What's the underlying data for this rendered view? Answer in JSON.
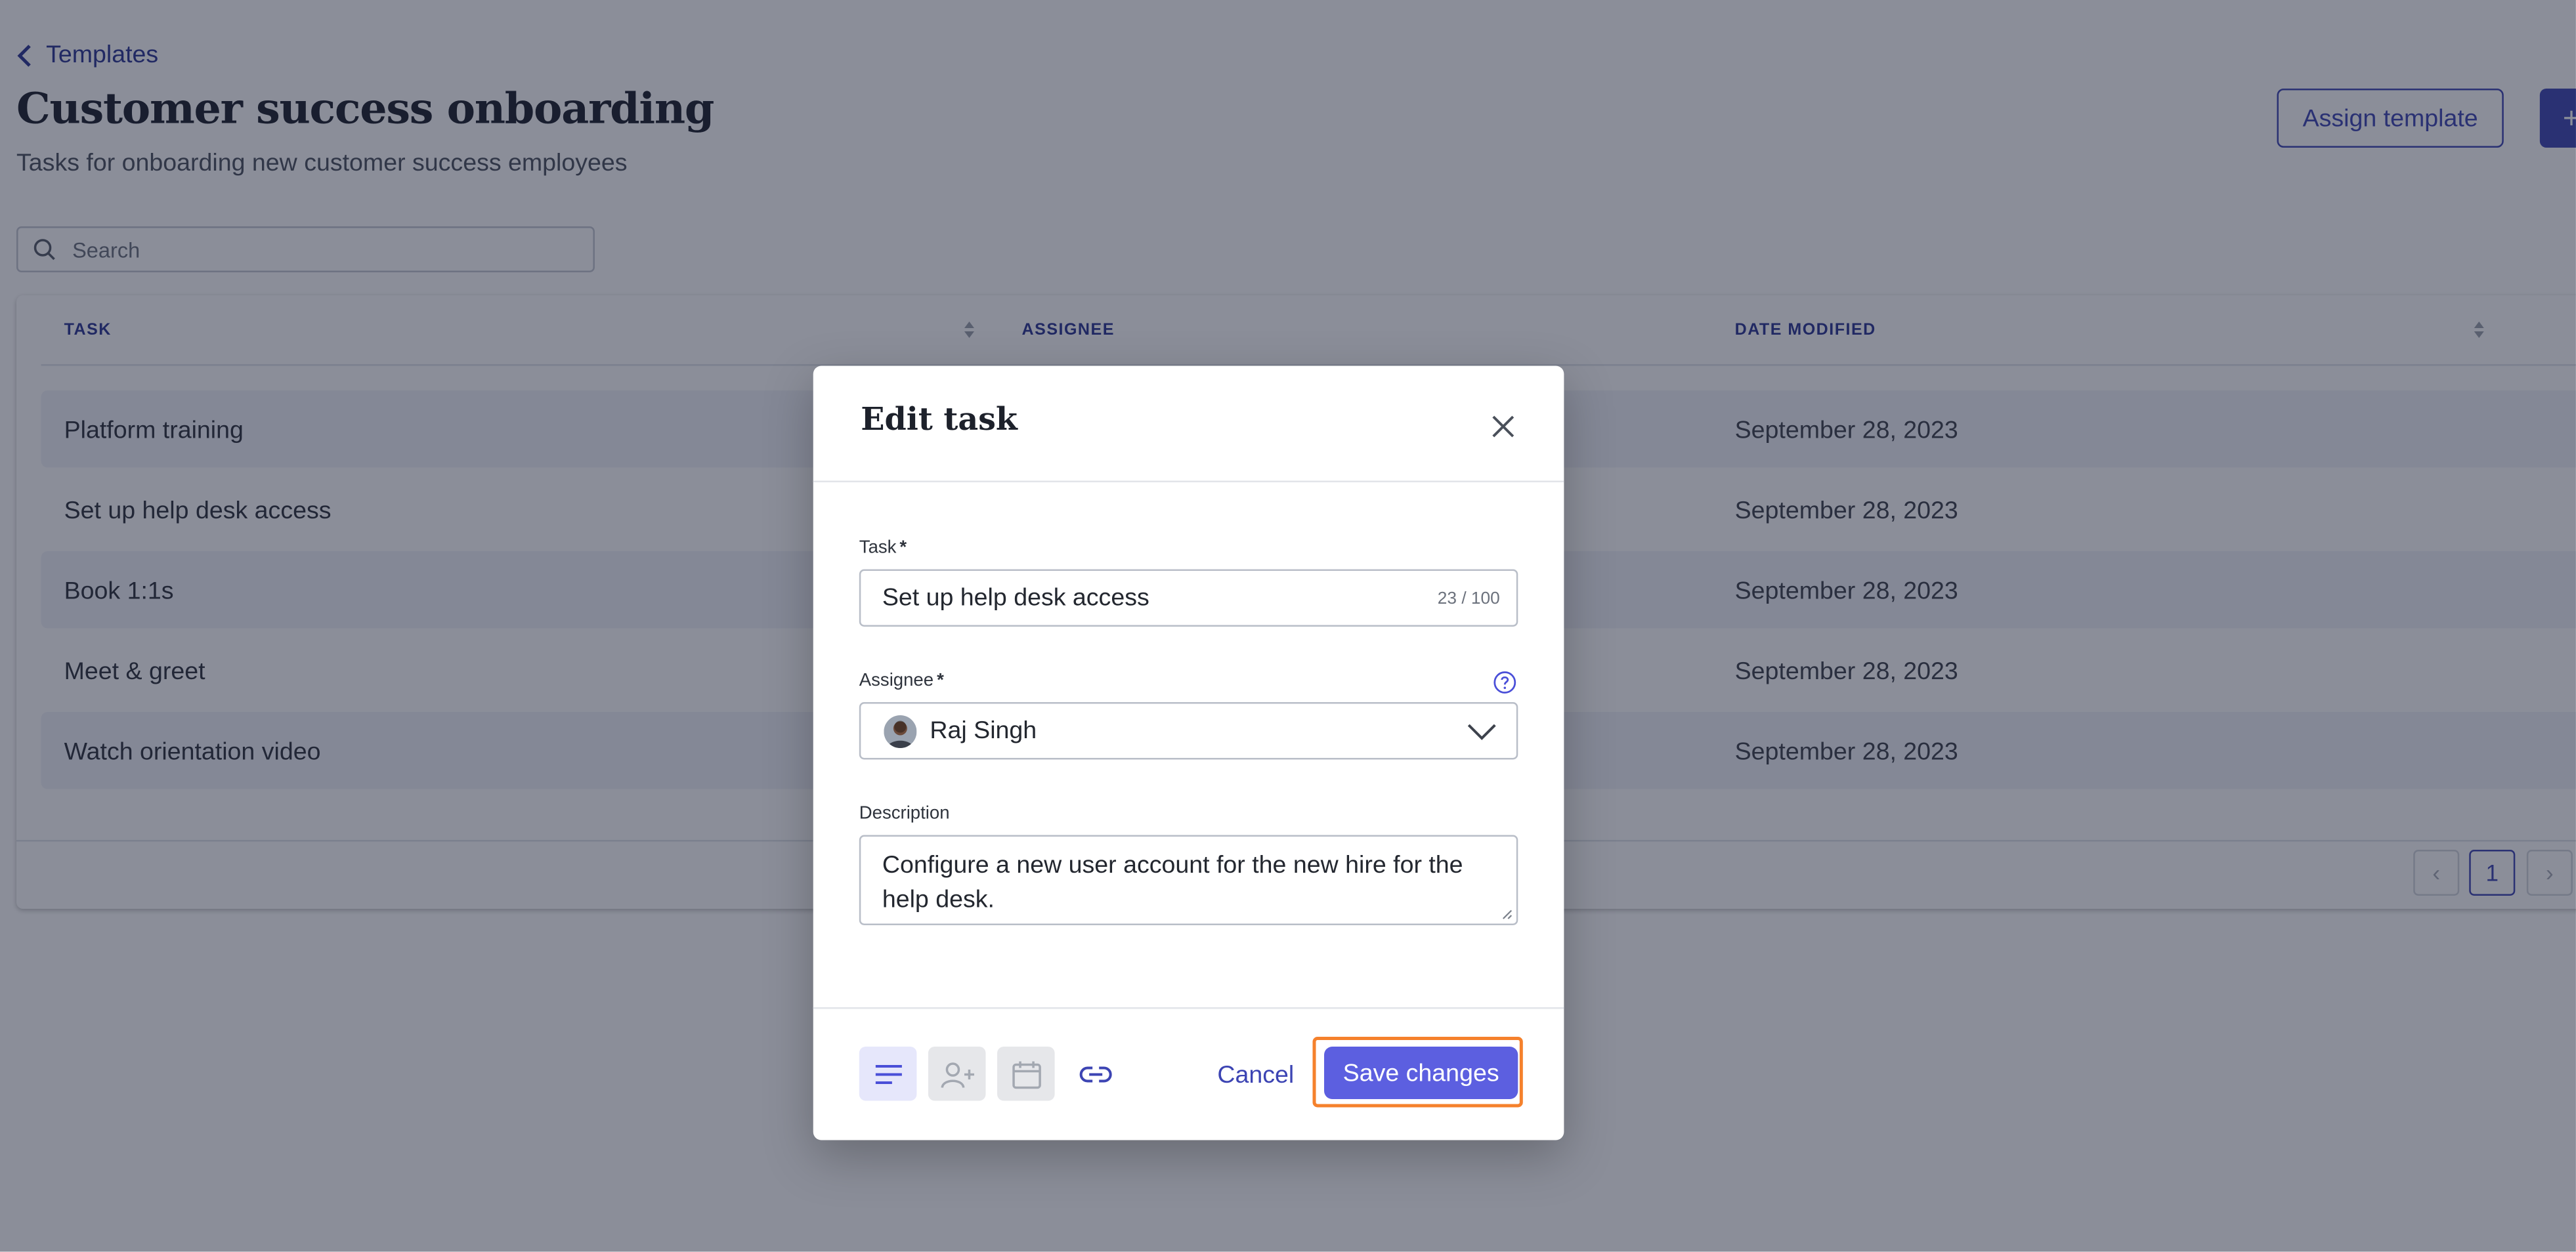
{
  "page": {
    "back_label": "Templates",
    "title": "Customer success onboarding",
    "subtitle": "Tasks for onboarding new customer success employees",
    "assign_label": "Assign template",
    "add_label": "+",
    "search_placeholder": "Search"
  },
  "table": {
    "columns": [
      "TASK",
      "ASSIGNEE",
      "DATE MODIFIED"
    ],
    "rows": [
      {
        "task": "Platform training",
        "date": "September 28, 2023"
      },
      {
        "task": "Set up help desk access",
        "date": "September 28, 2023"
      },
      {
        "task": "Book 1:1s",
        "date": "September 28, 2023"
      },
      {
        "task": "Meet & greet",
        "date": "September 28, 2023"
      },
      {
        "task": "Watch orientation video",
        "date": "September 28, 2023"
      }
    ],
    "pagination": {
      "prev": "‹",
      "current": "1",
      "next": "›"
    }
  },
  "modal": {
    "title": "Edit task",
    "task_label": "Task",
    "task_value": "Set up help desk access",
    "task_count": "23 / 100",
    "assignee_label": "Assignee",
    "assignee_value": "Raj Singh",
    "description_label": "Description",
    "description_value": "Configure a new user account for the new hire for the help desk.",
    "required_mark": "*",
    "cancel_label": "Cancel",
    "save_label": "Save changes"
  },
  "icons": {
    "back": "chevron-left-icon",
    "search": "search-icon",
    "sort": "sort-icon",
    "close": "close-icon",
    "help": "help-circle-icon",
    "dropdown": "chevron-down-icon",
    "toolbar": [
      "description-icon",
      "add-person-icon",
      "calendar-icon",
      "link-icon"
    ]
  },
  "colors": {
    "accent": "#3c44b3",
    "primary_button": "#5c5fe0",
    "highlight": "#f5812c",
    "overlay": "rgba(24, 30, 52, 0.5)"
  }
}
